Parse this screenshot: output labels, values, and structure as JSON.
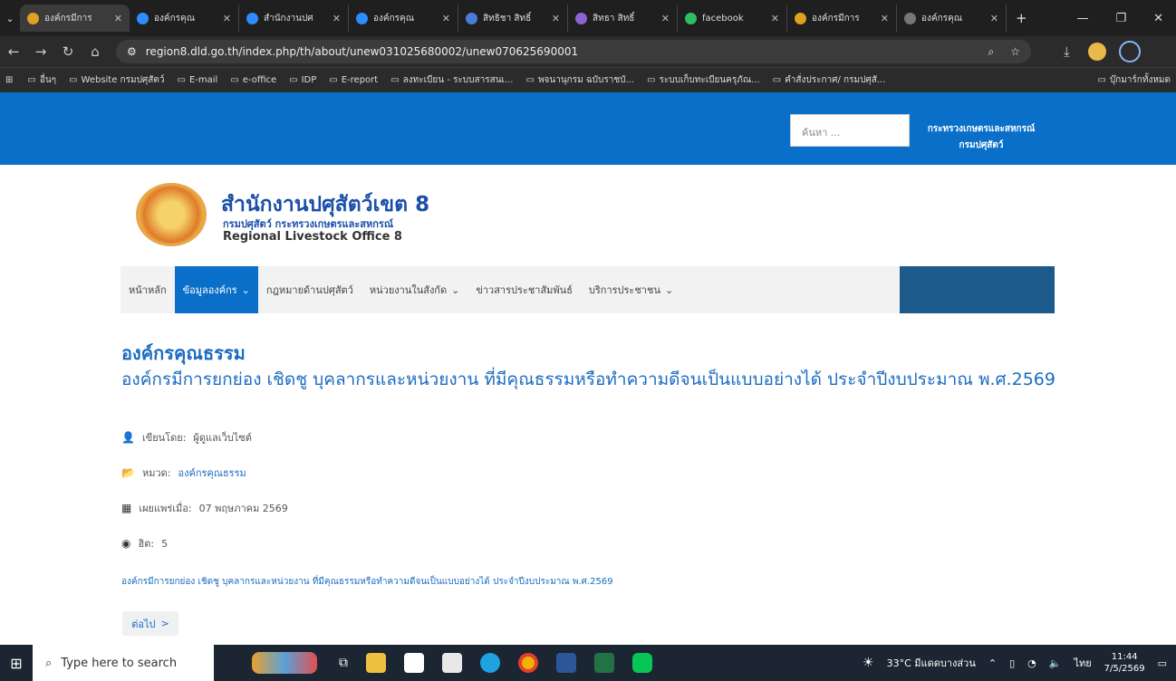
{
  "browser": {
    "tabs": [
      {
        "label": "องค์กรมีการ",
        "color": "#e0a020"
      },
      {
        "label": "องค์กรคุณ",
        "color": "#2d8cff"
      },
      {
        "label": "สำนักงานปศ",
        "color": "#2d8cff"
      },
      {
        "label": "องค์กรคุณ",
        "color": "#2d8cff"
      },
      {
        "label": "สิทธิชา สิทธิ์",
        "color": "#4a7bd8"
      },
      {
        "label": "สิทธา สิทธิ์",
        "color": "#8e63d6"
      },
      {
        "label": "facebook",
        "color": "#2dbe60"
      },
      {
        "label": "องค์กรมีการ",
        "color": "#e0a020"
      },
      {
        "label": "องค์กรคุณ",
        "color": "#777777"
      }
    ],
    "new_tab": "+",
    "url": "region8.dld.go.th/index.php/th/about/unew031025680002/unew070625690001",
    "bookmarks": [
      "อื่นๆ",
      "Website กรมปศุสัตว์",
      "E-mail",
      "e-office",
      "IDP",
      "E-report",
      "ลงทะเบียน - ระบบสารสนเ...",
      "พจนานุกรม ฉบับราชบั...",
      "ระบบเก็บทะเบียนครุภัณ...",
      "คำสั่งประกาศ/ กรมปศุสั..."
    ],
    "bookmarks_right": "บุ๊กมาร์กทั้งหมด"
  },
  "site": {
    "search_placeholder": "ค้นหา ...",
    "ministry_line1": "กระทรวงเกษตรและสหกรณ์",
    "ministry_line2": "กรมปศุสัตว์",
    "org_name": "สำนักงานปศุสัตว์เขต 8",
    "org_sub": "กรมปศุสัตว์ กระทรวงเกษตรและสหกรณ์",
    "org_en": "Regional Livestock Office 8",
    "menu": [
      {
        "label": "หน้าหลัก",
        "caret": ""
      },
      {
        "label": "ข้อมูลองค์กร",
        "caret": "⌄"
      },
      {
        "label": "กฎหมายด้านปศุสัตว์",
        "caret": ""
      },
      {
        "label": "หน่วยงานในสังกัด",
        "caret": "⌄"
      },
      {
        "label": "ข่าวสารประชาสัมพันธ์",
        "caret": ""
      },
      {
        "label": "บริการประชาชน",
        "caret": "⌄"
      }
    ]
  },
  "article": {
    "category_title": "องค์กรคุณธรรม",
    "title": "องค์กรมีการยกย่อง เชิดชู บุคลากรและหน่วยงาน ที่มีคุณธรรมหรือทำความดีจนเป็นแบบอย่างได้ ประจำปีงบประมาณ พ.ศ.2569",
    "author_label": "เขียนโดย:",
    "author": "ผู้ดูแลเว็บไซต์",
    "category_label": "หมวด:",
    "category": "องค์กรคุณธรรม",
    "published_label": "เผยแพร่เมื่อ:",
    "published": "07 พฤษภาคม 2569",
    "hits_label": "ฮิต:",
    "hits": "5",
    "body": "องค์กรมีการยกย่อง เชิดชู บุคลากรและหน่วยงาน ที่มีคุณธรรมหรือทำความดีจนเป็นแบบอย่างได้ ประจำปีงบประมาณ พ.ศ.2569",
    "next_label": "ต่อไป",
    "next_arrow": ">"
  },
  "taskbar": {
    "search_placeholder": "Type here to search",
    "weather": "33°C มีแดดบางส่วน",
    "lang": "ไทย",
    "time": "11:44",
    "date": "7/5/2569"
  }
}
